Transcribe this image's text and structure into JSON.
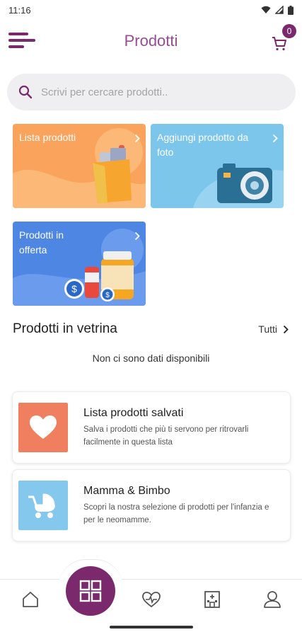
{
  "status_bar": {
    "time": "11:16"
  },
  "header": {
    "title": "Prodotti",
    "cart_count": "0"
  },
  "search": {
    "placeholder": "Scrivi per cercare prodotti.."
  },
  "tiles": [
    {
      "label": "Lista prodotti",
      "color": "#f9a35c"
    },
    {
      "label": "Aggiungi prodotto da foto",
      "color": "#7cc6ec"
    },
    {
      "label": "Prodotti in offerta",
      "color": "#4e86e4"
    }
  ],
  "featured": {
    "title": "Prodotti in vetrina",
    "see_all": "Tutti",
    "empty_message": "Non ci sono dati disponibili"
  },
  "cards": [
    {
      "title": "Lista prodotti salvati",
      "description": "Salva i prodotti che più ti servono per ritrovarli facilmente in questa lista",
      "icon": "heart-icon",
      "color": "#ef7f5e"
    },
    {
      "title": "Mamma & Bimbo",
      "description": "Scopri la nostra selezione di prodotti per l'infanzia e per le neomamme.",
      "icon": "stroller-icon",
      "color": "#84c8ee"
    }
  ],
  "bottom_nav": {
    "items": [
      "home-icon",
      "categories-icon",
      "health-icon",
      "pharmacy-icon",
      "profile-icon"
    ],
    "accent": "#7a2a6c"
  }
}
